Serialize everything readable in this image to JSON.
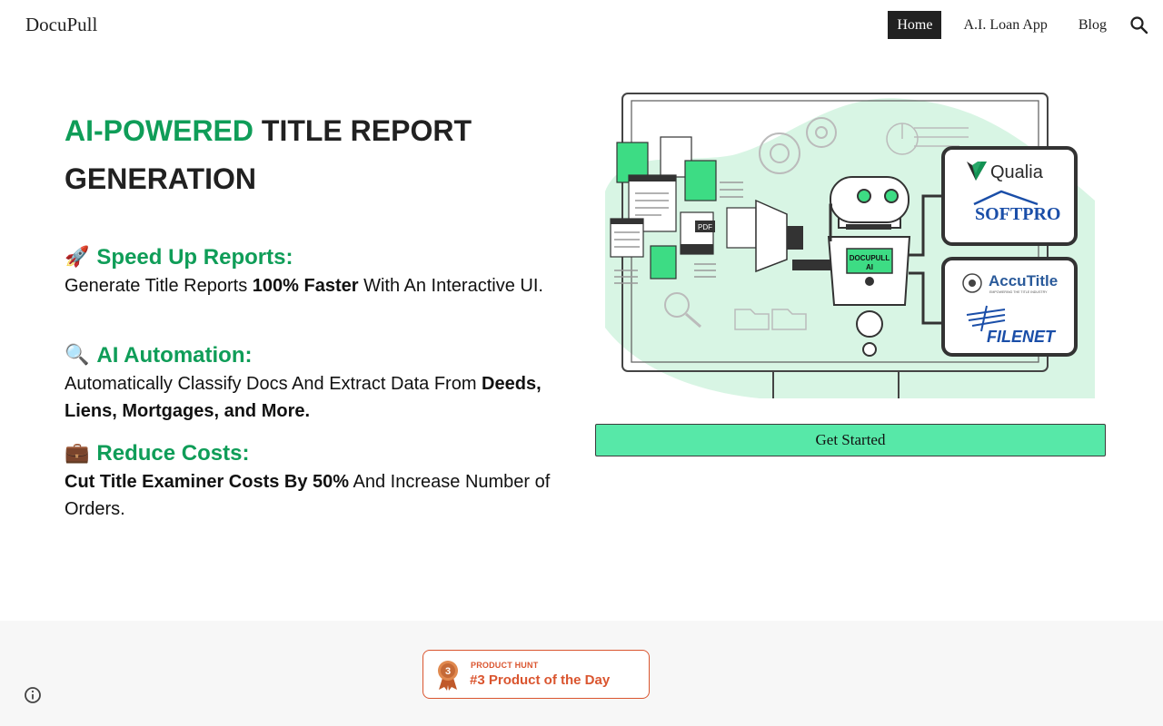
{
  "header": {
    "brand": "DocuPull",
    "nav": [
      {
        "label": "Home"
      },
      {
        "label": "A.I. Loan App"
      },
      {
        "label": "Blog"
      }
    ],
    "search_icon": "search-icon"
  },
  "hero": {
    "title_accent": "AI-POWERED",
    "title_rest": " TITLE REPORT GENERATION",
    "features": [
      {
        "emoji": "🚀",
        "heading": "Speed Up Reports:",
        "body_pre": "Generate Title Reports ",
        "body_bold": "100% Faster",
        "body_post": " With An Interactive UI."
      },
      {
        "emoji": "🔍",
        "heading": "AI Automation:",
        "body_pre": "Automatically Classify Docs And Extract Data From ",
        "body_bold": "Deeds, Liens, Mortgages, and More.",
        "body_post": ""
      },
      {
        "emoji": "💼",
        "heading": "Reduce Costs:",
        "body_pre": "",
        "body_bold": "Cut Title Examiner Costs By 50%",
        "body_post": " And Increase Number of Orders."
      }
    ]
  },
  "illustration": {
    "robot_label_1": "DOCUPULL",
    "robot_label_2": "AI",
    "pdf_label": "PDF",
    "logos_top": [
      "Qualia",
      "SOFTPRO"
    ],
    "logos_bottom": [
      "AccuTitle",
      "FILENET"
    ],
    "accutitle_tagline": "EMPOWERING THE TITLE INDUSTRY"
  },
  "cta": {
    "label": "Get Started"
  },
  "footer": {
    "badge_kicker": "PRODUCT HUNT",
    "badge_title": "#3 Product of the Day",
    "medal_number": "3"
  },
  "colors": {
    "accent_green": "#0f9d58",
    "cta_green": "#57e8a8",
    "blob_green": "#d8f5e4",
    "product_hunt": "#da552f"
  }
}
